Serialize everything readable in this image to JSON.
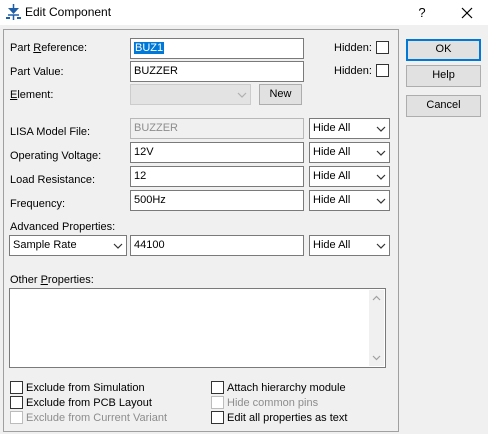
{
  "window": {
    "title": "Edit Component",
    "help_glyph": "?",
    "icons": {
      "app": "component-icon",
      "close": "close-icon"
    }
  },
  "buttons": {
    "ok": "OK",
    "help": "Help",
    "cancel": "Cancel",
    "new": "New"
  },
  "fields": {
    "part_reference": {
      "label_pre": "Part ",
      "label_u": "R",
      "label_post": "eference:",
      "value": "BUZ1",
      "hidden_label": "Hidden:"
    },
    "part_value": {
      "label": "Part Value:",
      "value": "BUZZER",
      "hidden_label": "Hidden:"
    },
    "element": {
      "label_u": "E",
      "label_post": "lement:",
      "value": ""
    }
  },
  "properties": [
    {
      "label": "LISA Model File:",
      "value": "BUZZER",
      "visibility": "Hide All",
      "disabled": true
    },
    {
      "label": "Operating Voltage:",
      "value": "12V",
      "visibility": "Hide All"
    },
    {
      "label": "Load Resistance:",
      "value": "12",
      "visibility": "Hide All"
    },
    {
      "label": "Frequency:",
      "value": "500Hz",
      "visibility": "Hide All"
    }
  ],
  "advanced": {
    "label": "Advanced Properties:",
    "property": "Sample Rate",
    "value": "44100",
    "visibility": "Hide All"
  },
  "other_properties": {
    "label_pre": "Other ",
    "label_u": "P",
    "label_post": "roperties:",
    "value": ""
  },
  "checkboxes": [
    {
      "label": "Exclude from Simulation",
      "checked": false,
      "enabled": true
    },
    {
      "label": "Exclude from PCB Layout",
      "checked": false,
      "enabled": true
    },
    {
      "label": "Exclude from Current Variant",
      "checked": false,
      "enabled": false
    },
    {
      "label": "Attach hierarchy module",
      "checked": false,
      "enabled": true
    },
    {
      "label": "Hide common pins",
      "checked": false,
      "enabled": false
    },
    {
      "label": "Edit all properties as text",
      "checked": false,
      "enabled": true
    }
  ],
  "colors": {
    "selection": "#0078d7",
    "dialog_bg": "#f0f0f0",
    "disabled_text": "#8d8d8d"
  }
}
